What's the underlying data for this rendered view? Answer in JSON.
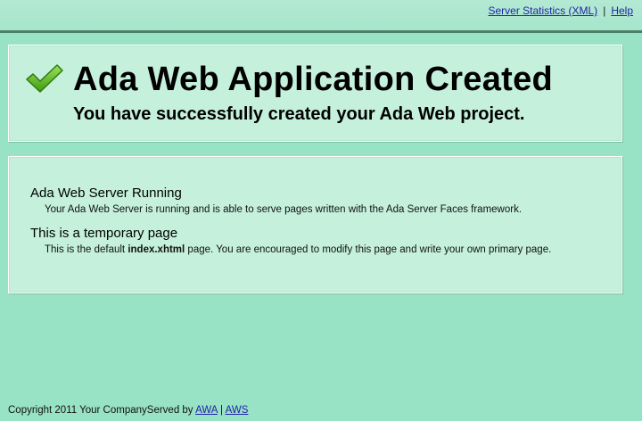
{
  "header": {
    "links": [
      {
        "label": "Server Statistics (XML)"
      },
      {
        "label": "Help"
      }
    ],
    "separator": "|"
  },
  "banner": {
    "title": "Ada Web Application Created",
    "subtitle": "You have successfully created your Ada Web project.",
    "icon": "check-icon",
    "icon_color": "#5fbf1f"
  },
  "content": {
    "sections": [
      {
        "heading": "Ada Web Server Running",
        "text": "Your Ada Web Server is running and is able to serve pages written with the Ada Server Faces framework."
      },
      {
        "heading": "This is a temporary page",
        "text_before": "This is the default ",
        "text_bold": "index.xhtml",
        "text_after": " page. You are encouraged to modify this page and write your own primary page."
      }
    ]
  },
  "footer": {
    "copyright": "Copyright 2011 Your Company",
    "served_by": "Served by ",
    "link1": "AWA",
    "separator": " | ",
    "link2": "AWS"
  },
  "colors": {
    "background": "#98e2c6",
    "panel": "#c4f0dc",
    "link": "#2222aa",
    "topbar_border": "#4a7d66"
  }
}
